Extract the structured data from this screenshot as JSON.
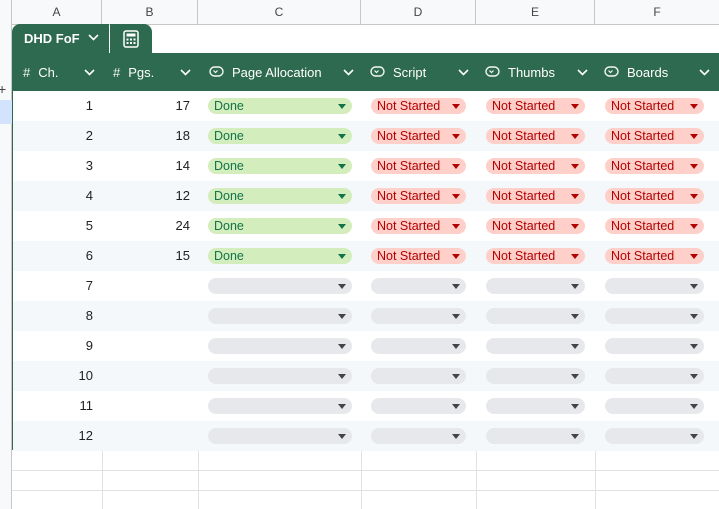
{
  "column_letters": [
    "A",
    "B",
    "C",
    "D",
    "E",
    "F"
  ],
  "table_tab": {
    "name": "DHD FoF",
    "icon": "calculator-icon"
  },
  "headers": [
    {
      "type_icon": "#",
      "label": "Ch."
    },
    {
      "type_icon": "#",
      "label": "Pgs."
    },
    {
      "type_icon": "dropdown-chip-icon",
      "label": "Page Allocation"
    },
    {
      "type_icon": "dropdown-chip-icon",
      "label": "Script"
    },
    {
      "type_icon": "dropdown-chip-icon",
      "label": "Thumbs"
    },
    {
      "type_icon": "dropdown-chip-icon",
      "label": "Boards"
    }
  ],
  "rows": [
    {
      "ch": "1",
      "pgs": "17",
      "page_allocation": "Done",
      "script": "Not Started",
      "thumbs": "Not Started",
      "boards": "Not Started"
    },
    {
      "ch": "2",
      "pgs": "18",
      "page_allocation": "Done",
      "script": "Not Started",
      "thumbs": "Not Started",
      "boards": "Not Started"
    },
    {
      "ch": "3",
      "pgs": "14",
      "page_allocation": "Done",
      "script": "Not Started",
      "thumbs": "Not Started",
      "boards": "Not Started"
    },
    {
      "ch": "4",
      "pgs": "12",
      "page_allocation": "Done",
      "script": "Not Started",
      "thumbs": "Not Started",
      "boards": "Not Started"
    },
    {
      "ch": "5",
      "pgs": "24",
      "page_allocation": "Done",
      "script": "Not Started",
      "thumbs": "Not Started",
      "boards": "Not Started"
    },
    {
      "ch": "6",
      "pgs": "15",
      "page_allocation": "Done",
      "script": "Not Started",
      "thumbs": "Not Started",
      "boards": "Not Started"
    },
    {
      "ch": "7",
      "pgs": "",
      "page_allocation": "",
      "script": "",
      "thumbs": "",
      "boards": ""
    },
    {
      "ch": "8",
      "pgs": "",
      "page_allocation": "",
      "script": "",
      "thumbs": "",
      "boards": ""
    },
    {
      "ch": "9",
      "pgs": "",
      "page_allocation": "",
      "script": "",
      "thumbs": "",
      "boards": ""
    },
    {
      "ch": "10",
      "pgs": "",
      "page_allocation": "",
      "script": "",
      "thumbs": "",
      "boards": ""
    },
    {
      "ch": "11",
      "pgs": "",
      "page_allocation": "",
      "script": "",
      "thumbs": "",
      "boards": ""
    },
    {
      "ch": "12",
      "pgs": "",
      "page_allocation": "",
      "script": "",
      "thumbs": "",
      "boards": ""
    }
  ],
  "colors": {
    "header_bg": "#2e6a4f",
    "done_bg": "#d4edbc",
    "done_text": "#11734b",
    "not_started_bg": "#ffcfc9",
    "not_started_text": "#b10202",
    "empty_chip_bg": "#e6e8eb"
  }
}
